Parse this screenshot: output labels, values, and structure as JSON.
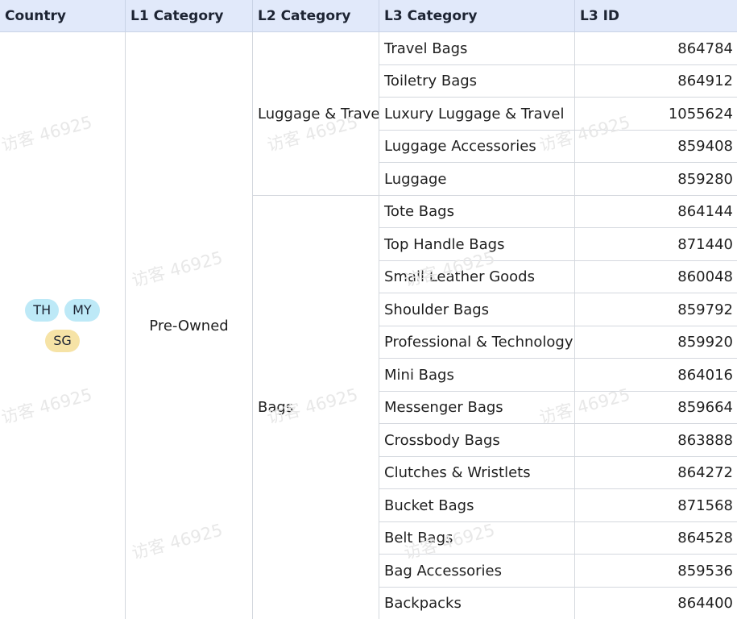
{
  "headers": {
    "country": "Country",
    "l1": "L1 Category",
    "l2": "L2 Category",
    "l3": "L3 Category",
    "l3id": "L3 ID"
  },
  "country_tags": [
    {
      "label": "TH",
      "color": "#bde9f7"
    },
    {
      "label": "MY",
      "color": "#bde9f7"
    },
    {
      "label": "SG",
      "color": "#f6e3a6"
    }
  ],
  "l1_category": "Pre-Owned",
  "l2_groups": [
    {
      "label": "Luggage & Travel"
    },
    {
      "label": "Bags"
    }
  ],
  "rows": [
    {
      "l3": "Travel Bags",
      "id": "864784"
    },
    {
      "l3": "Toiletry Bags",
      "id": "864912"
    },
    {
      "l3": "Luxury Luggage & Travel",
      "id": "1055624"
    },
    {
      "l3": "Luggage Accessories",
      "id": "859408"
    },
    {
      "l3": "Luggage",
      "id": "859280"
    },
    {
      "l3": "Tote Bags",
      "id": "864144"
    },
    {
      "l3": "Top Handle Bags",
      "id": "871440"
    },
    {
      "l3": "Small Leather Goods",
      "id": "860048"
    },
    {
      "l3": "Shoulder Bags",
      "id": "859792"
    },
    {
      "l3": "Professional & Technology Bags",
      "id": "859920"
    },
    {
      "l3": "Mini Bags",
      "id": "864016"
    },
    {
      "l3": "Messenger Bags",
      "id": "859664"
    },
    {
      "l3": "Crossbody Bags",
      "id": "863888"
    },
    {
      "l3": "Clutches & Wristlets",
      "id": "864272"
    },
    {
      "l3": "Bucket Bags",
      "id": "871568"
    },
    {
      "l3": "Belt Bags",
      "id": "864528"
    },
    {
      "l3": "Bag Accessories",
      "id": "859536"
    },
    {
      "l3": "Backpacks",
      "id": "864400"
    }
  ],
  "watermark": "访客 46925"
}
